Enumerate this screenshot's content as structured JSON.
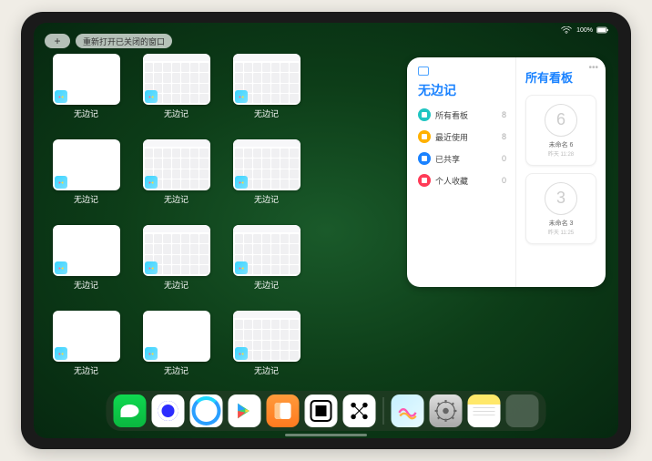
{
  "topbar": {
    "plus_label": "+",
    "reopen_label": "重新打开已关闭的窗口"
  },
  "status": {
    "battery_percent": "100%"
  },
  "app_switcher": {
    "app_label": "无边记",
    "thumbs": [
      {
        "type": "blank"
      },
      {
        "type": "content"
      },
      {
        "type": "content"
      },
      null,
      {
        "type": "blank"
      },
      {
        "type": "content"
      },
      {
        "type": "content"
      },
      null,
      {
        "type": "blank"
      },
      {
        "type": "content"
      },
      {
        "type": "content"
      },
      null,
      {
        "type": "blank"
      },
      {
        "type": "blank"
      },
      {
        "type": "content"
      },
      null
    ]
  },
  "widget": {
    "title": "无边记",
    "right_title": "所有看板",
    "ellipsis": "•••",
    "filters": [
      {
        "label": "所有看板",
        "count": 8,
        "color": "#20c5c2"
      },
      {
        "label": "最近使用",
        "count": 8,
        "color": "#ffb100"
      },
      {
        "label": "已共享",
        "count": 0,
        "color": "#1a82ff"
      },
      {
        "label": "个人收藏",
        "count": 0,
        "color": "#ff3b57"
      }
    ],
    "boards": [
      {
        "sketch": "6",
        "label": "未命名 6",
        "sublabel": "昨天 11:28"
      },
      {
        "sketch": "3",
        "label": "未命名 3",
        "sublabel": "昨天 11:25"
      }
    ]
  },
  "dock": {
    "icons": [
      {
        "name": "wechat-icon"
      },
      {
        "name": "quark-icon"
      },
      {
        "name": "qqbrowser-icon"
      },
      {
        "name": "play-store-icon"
      },
      {
        "name": "books-icon"
      },
      {
        "name": "dice-icon"
      },
      {
        "name": "network-icon"
      }
    ],
    "recent": [
      {
        "name": "freeform-icon"
      },
      {
        "name": "settings-icon"
      },
      {
        "name": "notes-icon"
      },
      {
        "name": "app-folder-icon"
      }
    ]
  }
}
